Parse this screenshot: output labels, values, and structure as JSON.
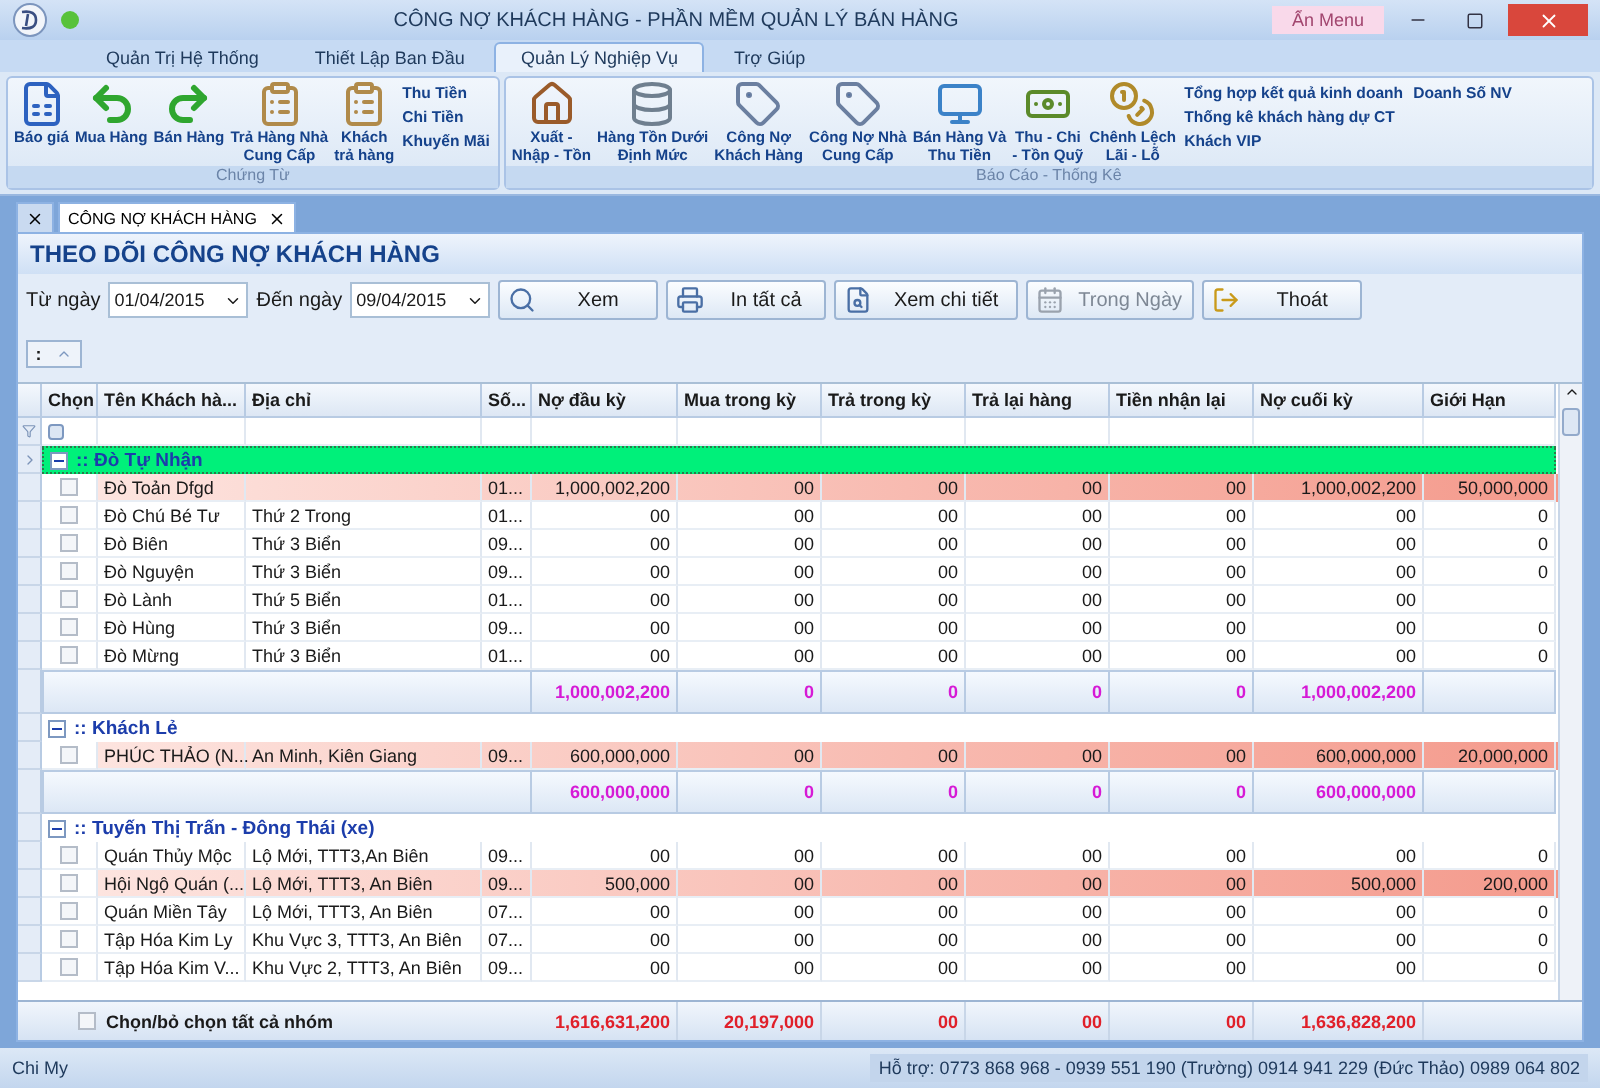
{
  "window": {
    "title": "CÔNG NỢ KHÁCH HÀNG - PHẦN MỀM QUẢN LÝ BÁN HÀNG",
    "menu_toggle": "Ẩn Menu"
  },
  "ribbon_tabs": [
    {
      "label": "Quản Trị Hệ Thống",
      "selected": false
    },
    {
      "label": "Thiết Lập Ban Đầu",
      "selected": false
    },
    {
      "label": "Quản Lý Nghiệp Vụ",
      "selected": true
    },
    {
      "label": "Trợ Giúp",
      "selected": false
    }
  ],
  "ribbon_groups": [
    {
      "title": "Chứng Từ",
      "buttons": [
        "Báo giá",
        "Mua Hàng",
        "Bán Hàng",
        "Trả Hàng Nhà\nCung Cấp",
        "Khách\ntrả hàng"
      ],
      "links": [
        [
          "Thu Tiền",
          "Chi Tiền",
          "Khuyến Mãi"
        ]
      ]
    },
    {
      "title": "Báo Cáo - Thống Kê",
      "buttons": [
        "Xuất -\nNhập - Tồn",
        "Hàng Tồn Dưới\nĐịnh Mức",
        "Công Nợ\nKhách Hàng",
        "Công Nợ Nhà\nCung Cấp",
        "Bán Hàng Và\nThu Tiền",
        "Thu - Chi\n- Tồn Quỹ",
        "Chênh Lệch\nLãi - Lỗ"
      ],
      "links": [
        [
          "Tổng hợp kết quả kinh doanh",
          "Thống kê khách hàng dự CT",
          "Khách VIP"
        ],
        [
          "Doanh Số NV"
        ]
      ]
    }
  ],
  "doc_tabs": [
    {
      "label": "CÔNG NỢ KHÁCH HÀNG",
      "selected": true
    }
  ],
  "heading": "THEO DÕI CÔNG NỢ KHÁCH HÀNG",
  "filter": {
    "from_label": "Từ ngày",
    "from": "01/04/2015",
    "to_label": "Đến ngày",
    "to": "09/04/2015"
  },
  "actions": [
    {
      "label": "Xem",
      "disabled": false
    },
    {
      "label": "In tất cả",
      "disabled": false
    },
    {
      "label": "Xem chi tiết",
      "disabled": false
    },
    {
      "label": "Trong Ngày",
      "disabled": true
    },
    {
      "label": "Thoát",
      "disabled": false
    }
  ],
  "group_panel": ":",
  "columns": [
    "Chọn",
    "Tên Khách hà...",
    "Địa chỉ",
    "Số...",
    "Nợ đầu kỳ",
    "Mua trong kỳ",
    "Trả trong kỳ",
    "Trả lại hàng",
    "Tiền nhận lại",
    "Nợ cuối kỳ",
    "Giới Hạn"
  ],
  "groups": [
    {
      "name": ":: Đò Tự Nhận",
      "selected": true,
      "expanded": true,
      "rows": [
        {
          "checked": false,
          "over_limit": true,
          "cells": [
            "Đò Toản Dfgd",
            null,
            "01...",
            "1,000,002,200",
            "00",
            "00",
            "00",
            "00",
            "1,000,002,200",
            "50,000,000"
          ]
        },
        {
          "checked": false,
          "over_limit": false,
          "cells": [
            "Đò Chú Bé Tư",
            "Thứ 2 Trong",
            "01...",
            "00",
            "00",
            "00",
            "00",
            "00",
            "00",
            "0"
          ]
        },
        {
          "checked": false,
          "over_limit": false,
          "cells": [
            "Đò Biên",
            "Thứ 3 Biển",
            "09...",
            "00",
            "00",
            "00",
            "00",
            "00",
            "00",
            "0"
          ]
        },
        {
          "checked": false,
          "over_limit": false,
          "cells": [
            "Đò Nguyện",
            "Thứ 3 Biển",
            "09...",
            "00",
            "00",
            "00",
            "00",
            "00",
            "00",
            "0"
          ]
        },
        {
          "checked": false,
          "over_limit": false,
          "cells": [
            "Đò Lành",
            "Thứ 5 Biển",
            "01...",
            "00",
            "00",
            "00",
            "00",
            "00",
            "00",
            null
          ]
        },
        {
          "checked": false,
          "over_limit": false,
          "cells": [
            "Đò Hùng",
            "Thứ 3 Biển",
            "09...",
            "00",
            "00",
            "00",
            "00",
            "00",
            "00",
            "0"
          ]
        },
        {
          "checked": false,
          "over_limit": false,
          "cells": [
            "Đò Mừng",
            "Thứ 3 Biển",
            "01...",
            "00",
            "00",
            "00",
            "00",
            "00",
            "00",
            "0"
          ]
        }
      ],
      "totals": [
        "1,000,002,200",
        "0",
        "0",
        "0",
        "0",
        "1,000,002,200"
      ]
    },
    {
      "name": ":: Khách Lẻ",
      "selected": false,
      "expanded": true,
      "rows": [
        {
          "checked": false,
          "over_limit": true,
          "cells": [
            "PHÚC THẢO (N...",
            "An Minh, Kiên Giang",
            "09...",
            "600,000,000",
            "00",
            "00",
            "00",
            "00",
            "600,000,000",
            "20,000,000"
          ]
        }
      ],
      "totals": [
        "600,000,000",
        "0",
        "0",
        "0",
        "0",
        "600,000,000"
      ]
    },
    {
      "name": ":: Tuyến  Thị Trấn - Đông Thái (xe)",
      "selected": false,
      "expanded": true,
      "rows": [
        {
          "checked": false,
          "over_limit": false,
          "cells": [
            "Quán Thủy Mộc",
            "Lộ Mới, TTT3,An Biên",
            "09...",
            "00",
            "00",
            "00",
            "00",
            "00",
            "00",
            "0"
          ]
        },
        {
          "checked": false,
          "over_limit": true,
          "cells": [
            "Hội Ngộ Quán (...",
            "Lộ Mới, TTT3, An Biên",
            "09...",
            "500,000",
            "00",
            "00",
            "00",
            "00",
            "500,000",
            "200,000"
          ]
        },
        {
          "checked": false,
          "over_limit": false,
          "cells": [
            "Quán Miền Tây",
            "Lộ Mới, TTT3, An Biên",
            "07...",
            "00",
            "00",
            "00",
            "00",
            "00",
            "00",
            "0"
          ]
        },
        {
          "checked": false,
          "over_limit": false,
          "cells": [
            "Tập Hóa Kim Ly",
            "Khu Vực 3, TTT3, An Biên",
            "07...",
            "00",
            "00",
            "00",
            "00",
            "00",
            "00",
            "0"
          ]
        },
        {
          "checked": false,
          "over_limit": false,
          "cells": [
            "Tập Hóa Kim V...",
            "Khu Vực 2, TTT3, An Biên",
            "09...",
            "00",
            "00",
            "00",
            "00",
            "00",
            "00",
            "0"
          ]
        }
      ]
    }
  ],
  "footer": {
    "select_all_label": "Chọn/bỏ chọn tất cả nhóm",
    "select_all_checked": false,
    "totals": [
      "1,616,631,200",
      "20,197,000",
      "00",
      "00",
      "00",
      "1,636,828,200"
    ]
  },
  "status_bar": {
    "user": "Chi My",
    "support": "Hỗ trợ: 0773 868 968 - 0939 551 190 (Trường) 0914 941 229 (Đức Thảo) 0989 064 802"
  }
}
